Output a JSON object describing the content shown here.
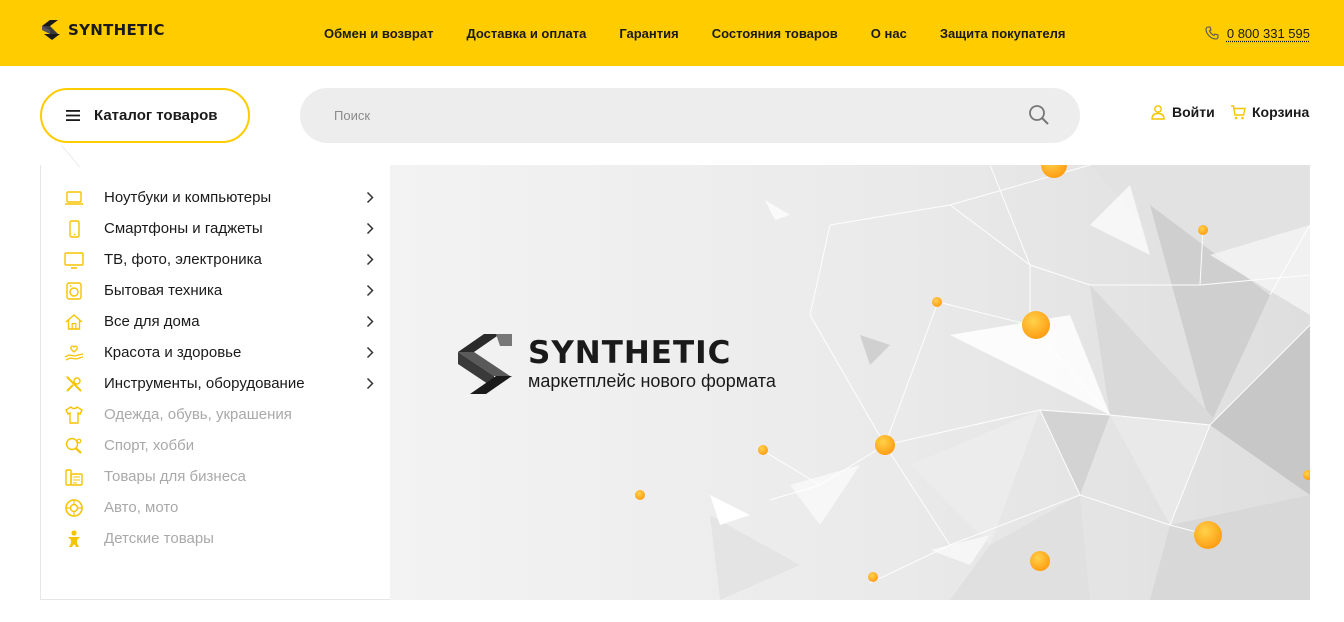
{
  "header": {
    "logo_text": "SYNTHETIC",
    "nav": [
      {
        "label": "Обмен и возврат"
      },
      {
        "label": "Доставка и оплата"
      },
      {
        "label": "Гарантия"
      },
      {
        "label": "Состояния товаров"
      },
      {
        "label": "О нас"
      },
      {
        "label": "Защита покупателя"
      }
    ],
    "phone": "0 800 331 595"
  },
  "toolbar": {
    "catalog_label": "Каталог товаров",
    "search_placeholder": "Поиск",
    "search_value": "",
    "login_label": "Войти",
    "cart_label": "Корзина"
  },
  "catalog": {
    "items": [
      {
        "label": "Ноутбуки и компьютеры",
        "icon": "laptop-icon",
        "enabled": true
      },
      {
        "label": "Смартфоны и гаджеты",
        "icon": "smartphone-icon",
        "enabled": true
      },
      {
        "label": "ТВ, фото, электроника",
        "icon": "tv-icon",
        "enabled": true
      },
      {
        "label": "Бытовая техника",
        "icon": "washing-machine-icon",
        "enabled": true
      },
      {
        "label": "Все для дома",
        "icon": "home-icon",
        "enabled": true
      },
      {
        "label": "Красота и здоровье",
        "icon": "hand-heart-icon",
        "enabled": true
      },
      {
        "label": "Инструменты, оборудование",
        "icon": "tools-icon",
        "enabled": true
      },
      {
        "label": "Одежда, обувь, украшения",
        "icon": "tshirt-icon",
        "enabled": false
      },
      {
        "label": "Спорт, хобби",
        "icon": "ping-pong-icon",
        "enabled": false
      },
      {
        "label": "Товары для бизнеса",
        "icon": "fax-icon",
        "enabled": false
      },
      {
        "label": "Авто, мото",
        "icon": "wheel-icon",
        "enabled": false
      },
      {
        "label": "Детские товары",
        "icon": "child-icon",
        "enabled": false
      }
    ]
  },
  "banner": {
    "brand_name": "SYNTHETIC",
    "tagline": "маркетплейс нового формата"
  },
  "colors": {
    "accent": "#ffcc00",
    "icon_yellow": "#f5c400",
    "orb_orange": "#ffa51a",
    "text": "#1a1a1a",
    "muted": "#a9a9a9"
  }
}
